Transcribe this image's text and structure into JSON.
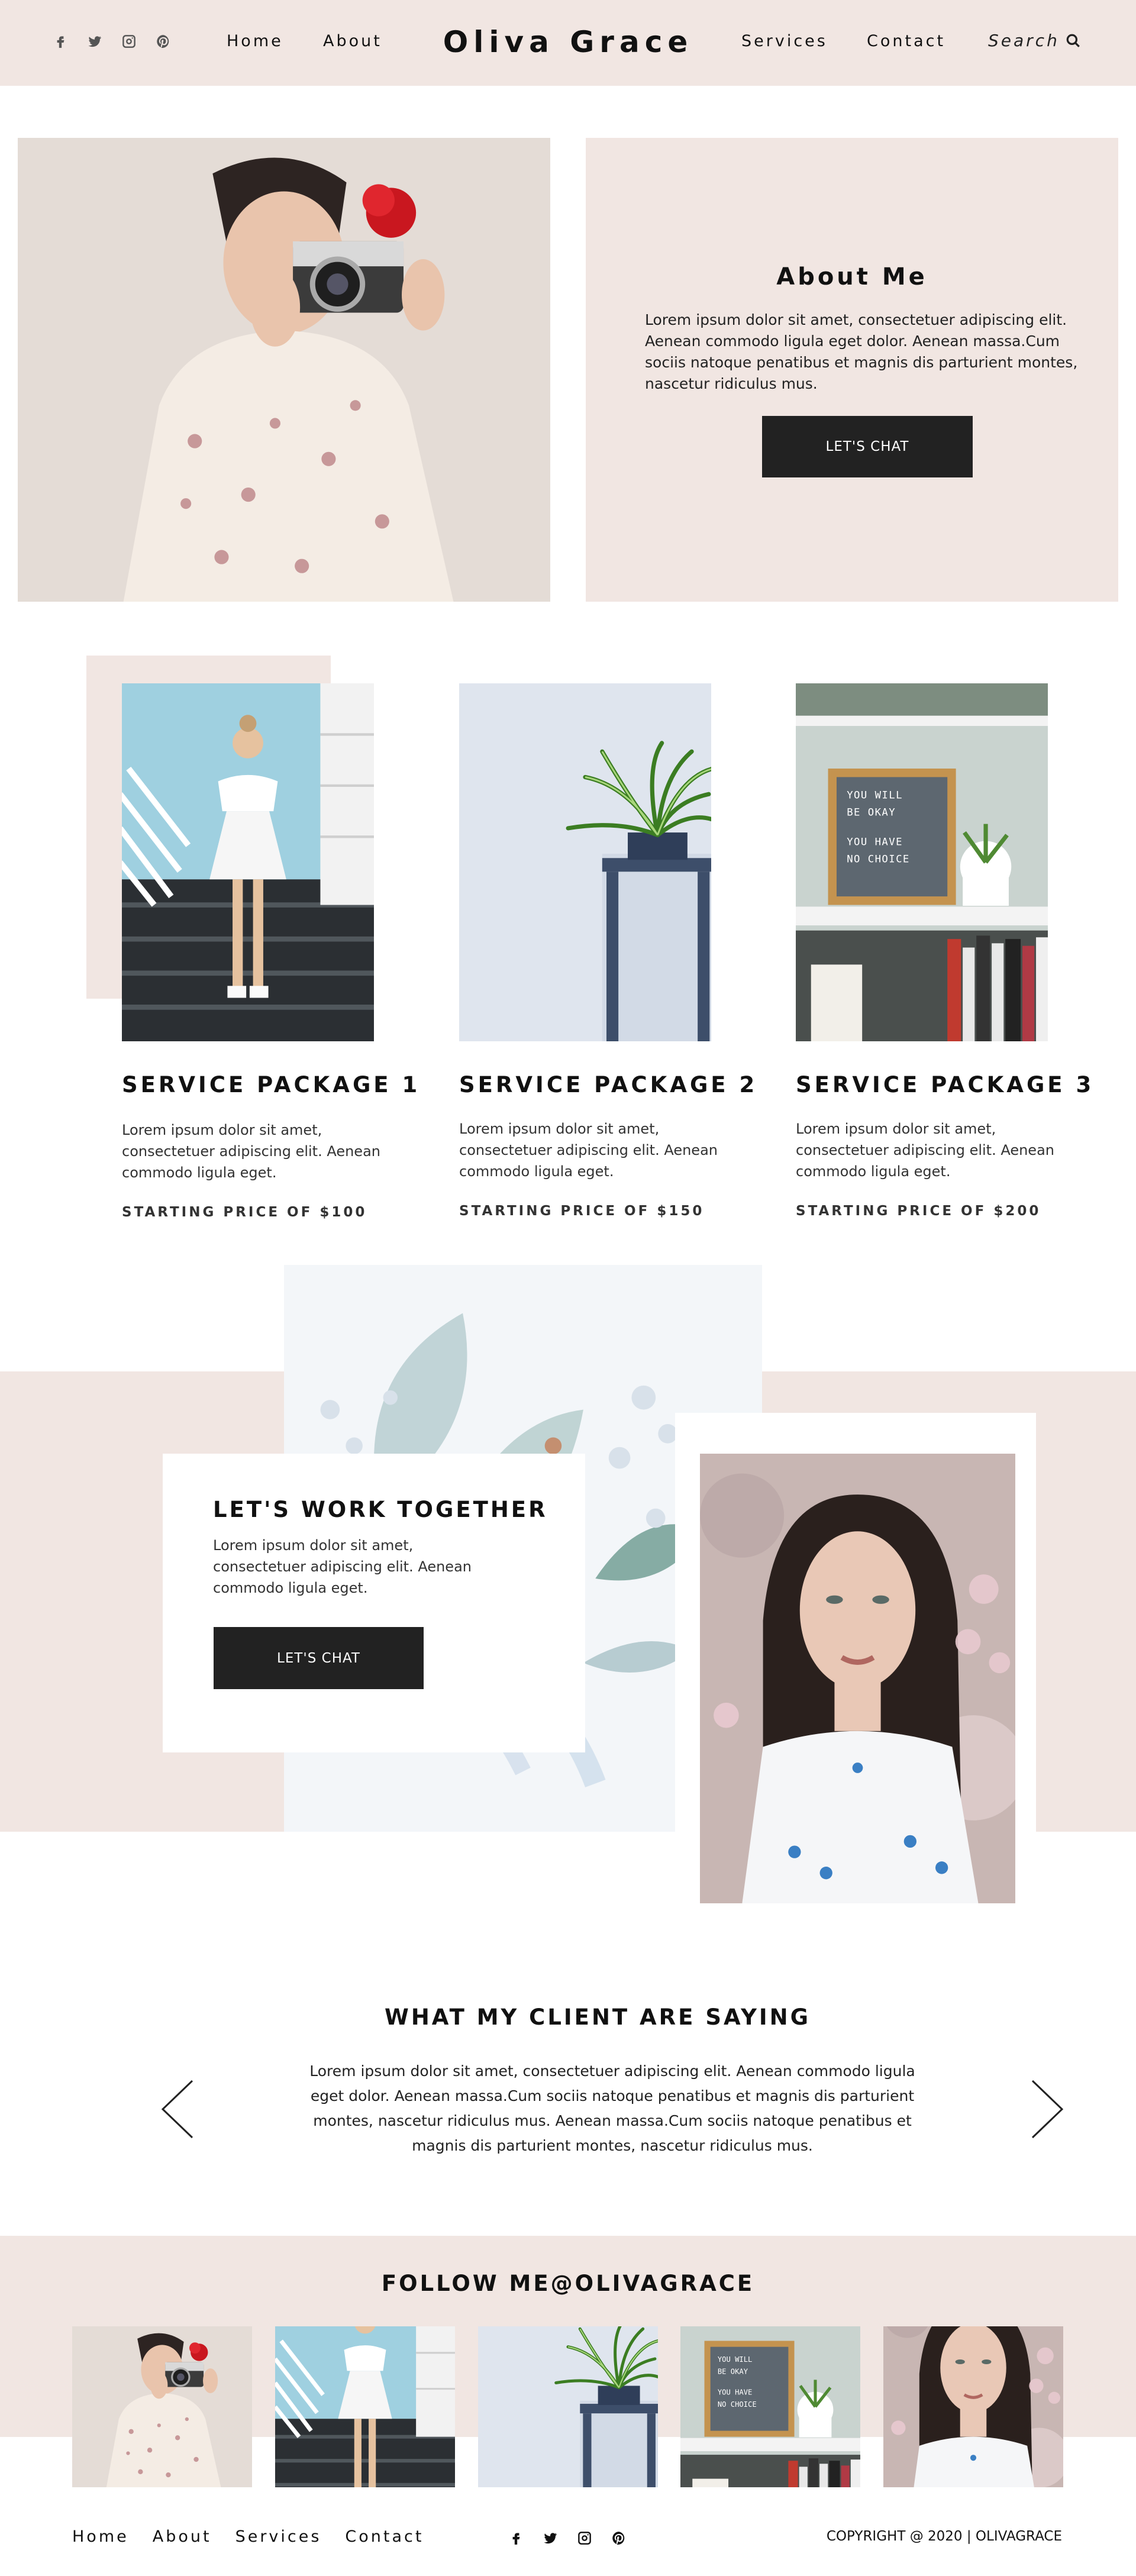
{
  "colors": {
    "blush": "#f1e6e2",
    "dark_button": "#222222",
    "text": "#1e1e1e"
  },
  "header": {
    "social_icons": [
      "facebook-icon",
      "twitter-icon",
      "instagram-icon",
      "pinterest-icon"
    ],
    "nav_left": [
      "Home",
      "About"
    ],
    "brand": "Oliva Grace",
    "nav_right": [
      "Services",
      "Contact"
    ],
    "search_label": "Search",
    "search_icon": "search-icon"
  },
  "about": {
    "title": "About Me",
    "body": "Lorem ipsum dolor sit amet, consectetuer adipiscing elit. Aenean commodo ligula eget dolor. Aenean massa.Cum sociis natoque penatibus et magnis dis parturient montes, nascetur ridiculus mus.",
    "button": "LET'S CHAT"
  },
  "services": [
    {
      "title": "SERVICE PACKAGE 1",
      "desc": "Lorem ipsum dolor sit amet, consectetuer adipiscing elit. Aenean commodo ligula eget.",
      "price": "STARTING PRICE OF $100"
    },
    {
      "title": "SERVICE PACKAGE 2",
      "desc": "Lorem ipsum dolor sit amet, consectetuer adipiscing elit. Aenean commodo ligula eget.",
      "price": "STARTING PRICE OF $150"
    },
    {
      "title": "SERVICE PACKAGE 3",
      "desc": "Lorem ipsum dolor sit amet, consectetuer adipiscing elit. Aenean commodo ligula eget.",
      "price": "STARTING PRICE OF $200"
    }
  ],
  "letterboard": {
    "line1": "YOU WILL",
    "line2": "BE OKAY",
    "line3": "YOU HAVE",
    "line4": "NO CHOICE"
  },
  "work": {
    "title": "LET'S WORK TOGETHER",
    "body": "Lorem ipsum dolor sit amet, consectetuer adipiscing elit. Aenean commodo ligula eget.",
    "button": "LET'S CHAT"
  },
  "testimonials": {
    "title": "WHAT MY CLIENT ARE SAYING",
    "body": "Lorem ipsum dolor sit amet, consectetuer adipiscing elit. Aenean commodo ligula eget dolor. Aenean massa.Cum sociis natoque penatibus et magnis dis parturient montes, nascetur ridiculus mus. Aenean massa.Cum sociis natoque penatibus et magnis dis parturient montes, nascetur ridiculus mus."
  },
  "follow": {
    "title": "FOLLOW ME@OLIVAGRACE"
  },
  "footer": {
    "nav": [
      "Home",
      "About",
      "Services",
      "Contact"
    ],
    "social_icons": [
      "facebook-icon",
      "twitter-icon",
      "instagram-icon",
      "pinterest-icon"
    ],
    "copyright": "COPYRIGHT @ 2020 | OLIVAGRACE"
  }
}
